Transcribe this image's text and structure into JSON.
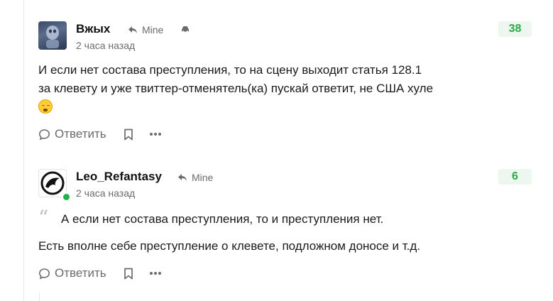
{
  "comments": [
    {
      "author": "Вжых",
      "reply_to": "Mine",
      "time": "2 часа назад",
      "rating": "38",
      "text_line1": "И если нет состава преступления, то на сцену выходит статья 128.1",
      "text_line2": "за клевету и уже твиттер-отменятель(ка) пускай ответит, не США хуле",
      "reply_label": "Ответить"
    },
    {
      "author": "Leo_Refantasy",
      "reply_to": "Mine",
      "time": "2 часа назад",
      "rating": "6",
      "quote_mark": "“",
      "quote": "А если нет состава преступления, то и преступления нет.",
      "text": "Есть вполне себе преступление о клевете, подложном доносе и т.д.",
      "reply_label": "Ответить"
    }
  ],
  "colors": {
    "rating_text": "#2ba84a",
    "rating_bg": "#eef7ef",
    "muted": "#6b6b6b",
    "online": "#22b14c"
  },
  "icons": [
    "reply-arrow-icon",
    "car-icon",
    "speech-bubble-icon",
    "bookmark-icon",
    "more-icon",
    "emoji-icon"
  ]
}
